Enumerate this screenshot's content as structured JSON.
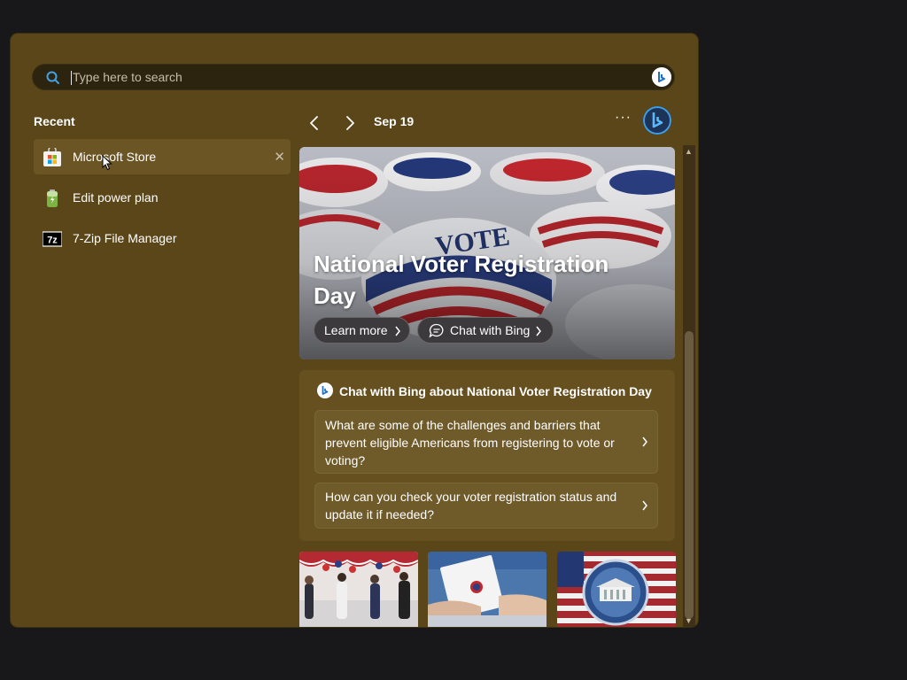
{
  "search": {
    "placeholder": "Type here to search"
  },
  "recent": {
    "heading": "Recent",
    "items": [
      {
        "label": "Microsoft Store",
        "icon": "microsoft-store-icon"
      },
      {
        "label": "Edit power plan",
        "icon": "battery-icon"
      },
      {
        "label": "7-Zip File Manager",
        "icon": "7zip-icon"
      }
    ]
  },
  "feed": {
    "date": "Sep 19",
    "more_label": "···",
    "hero": {
      "title": "National Voter Registration Day",
      "learn_more": "Learn more",
      "chat_with_bing": "Chat with Bing"
    },
    "chat": {
      "heading": "Chat with Bing about National Voter Registration Day",
      "questions": [
        "What are some of the challenges and barriers that prevent eligible Americans from registering to vote or voting?",
        "How can you check your voter registration status and update it if needed?"
      ]
    }
  },
  "colors": {
    "panel": "#5b4619",
    "accent_bing": "#2f8fd8"
  }
}
